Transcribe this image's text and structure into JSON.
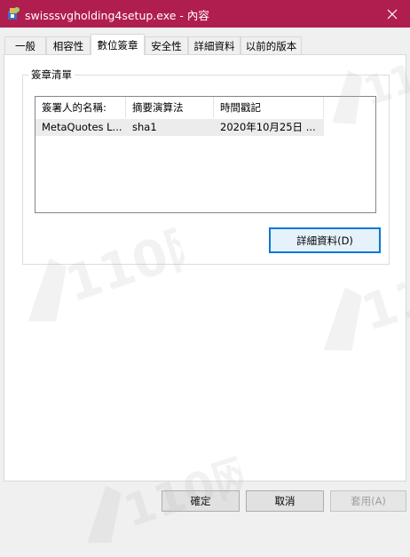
{
  "window": {
    "title": "swisssvgholding4setup.exe - 內容",
    "close_label": "✕"
  },
  "tabs": [
    {
      "label": "一般",
      "active": false
    },
    {
      "label": "相容性",
      "active": false
    },
    {
      "label": "數位簽章",
      "active": true
    },
    {
      "label": "安全性",
      "active": false
    },
    {
      "label": "詳細資料",
      "active": false
    },
    {
      "label": "以前的版本",
      "active": false
    }
  ],
  "signature_group": {
    "label": "簽章清單",
    "columns": [
      "簽署人的名稱:",
      "摘要演算法",
      "時間戳記"
    ],
    "rows": [
      {
        "name": "MetaQuotes L...",
        "algorithm": "sha1",
        "timestamp": "2020年10月25日 ..."
      }
    ],
    "details_button": "詳細資料(D)"
  },
  "footer": {
    "ok": "確定",
    "cancel": "取消",
    "apply": "套用(A)"
  },
  "watermark": {
    "text": "110网"
  },
  "colors": {
    "titlebar": "#b01e4f",
    "focus": "#0078d7"
  }
}
